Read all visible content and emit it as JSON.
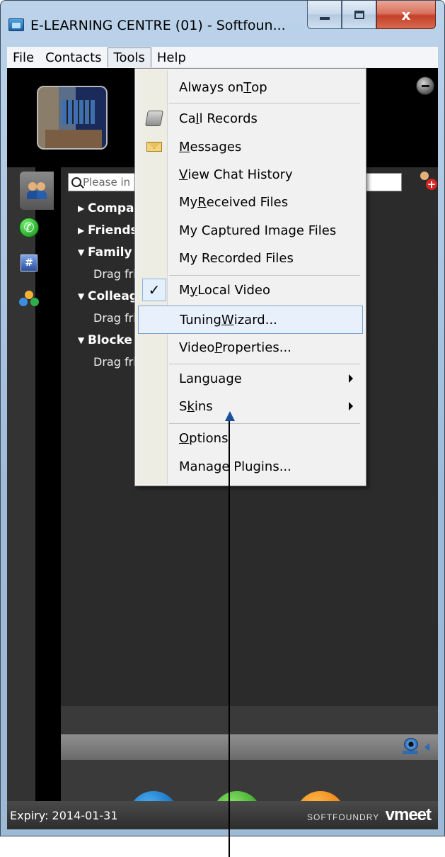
{
  "window": {
    "title": "E-LEARNING CENTRE (01) - Softfoun...",
    "close_glyph": "x"
  },
  "menubar": {
    "items": [
      {
        "label": "File"
      },
      {
        "label": "Contacts"
      },
      {
        "label": "Tools"
      },
      {
        "label": "Help"
      }
    ],
    "active": "Tools"
  },
  "contacts": {
    "search_placeholder": "Please in",
    "groups": [
      {
        "label": "Compa",
        "expanded": false
      },
      {
        "label": "Friends",
        "expanded": false
      },
      {
        "label": "Family",
        "expanded": true,
        "child": "Drag fri"
      },
      {
        "label": "Colleag",
        "expanded": true,
        "child": "Drag fri"
      },
      {
        "label": "Blocke",
        "expanded": true,
        "child": "Drag fri"
      }
    ]
  },
  "sidebar": {
    "hash_label": "#"
  },
  "tools_menu": {
    "items": [
      {
        "pre": "Always on ",
        "acc": "T",
        "post": "op"
      },
      {
        "pre": "Ca",
        "acc": "l",
        "post": "l Records",
        "icon": "call-records-icon"
      },
      {
        "pre": "",
        "acc": "M",
        "post": "essages",
        "icon": "messages-icon"
      },
      {
        "pre": "",
        "acc": "V",
        "post": "iew Chat History"
      },
      {
        "pre": "My ",
        "acc": "R",
        "post": "eceived Files"
      },
      {
        "pre": "My Captured Image Files",
        "acc": "",
        "post": ""
      },
      {
        "pre": "My Recorded Files",
        "acc": "",
        "post": ""
      },
      {
        "pre": "M",
        "acc": "y",
        "post": " Local Video",
        "checked": true
      },
      {
        "pre": "Tuning ",
        "acc": "W",
        "post": "izard...",
        "highlighted": true
      },
      {
        "pre": "Video ",
        "acc": "P",
        "post": "roperties..."
      },
      {
        "pre": "Langua",
        "acc": "g",
        "post": "e",
        "submenu": true
      },
      {
        "pre": "S",
        "acc": "k",
        "post": "ins",
        "submenu": true
      },
      {
        "pre": "",
        "acc": "O",
        "post": "ptions"
      },
      {
        "pre": "Manage Plugins...",
        "acc": "",
        "post": ""
      }
    ],
    "check_glyph": "✓"
  },
  "status": {
    "expiry": "Expiry: 2014-01-31",
    "brand_small": "SOFTFOUNDRY",
    "brand_large": "vmeet"
  }
}
